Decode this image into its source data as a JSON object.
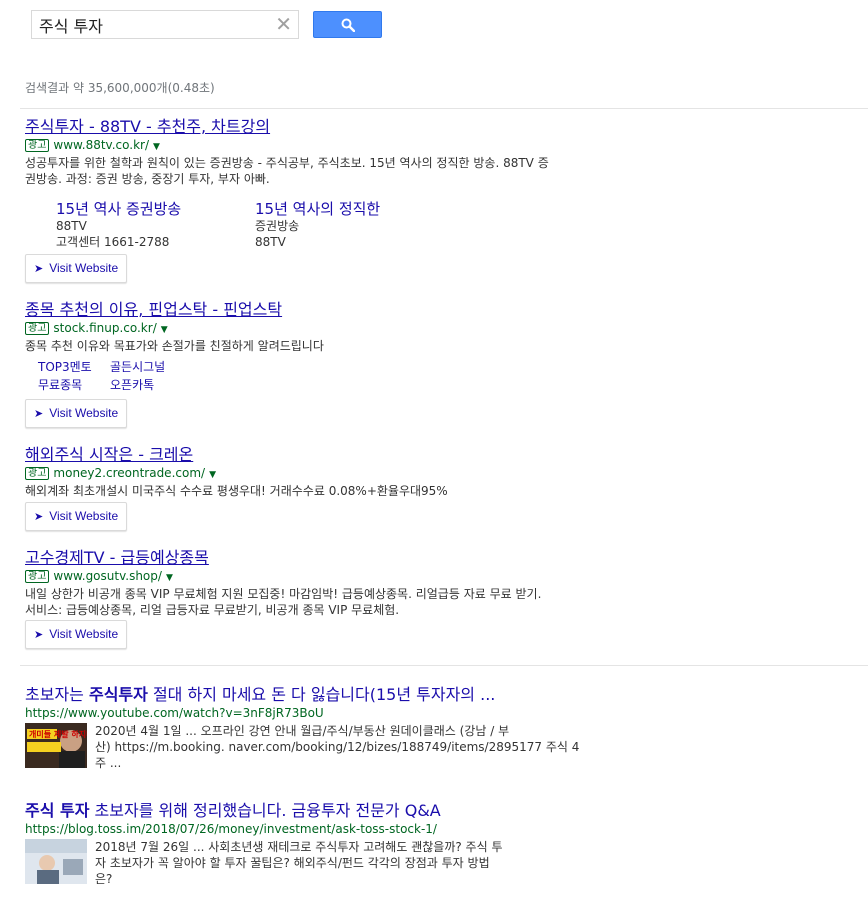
{
  "search": {
    "query": "주식 투자",
    "clear_glyph": "✕",
    "button_icon": "search-icon",
    "stats": "검색결과 약 35,600,000개(0.48초)"
  },
  "colors": {
    "link": "#1a0dab",
    "url_green": "#006621",
    "button_blue": "#4d90fe"
  },
  "ads": [
    {
      "title": "주식투자 - 88TV - 추천주, 차트강의",
      "badge": "광고",
      "url": "www.88tv.co.kr/",
      "desc": [
        "성공투자를 위한 철학과 원칙이 있는 증권방송 - 주식공부, 주식초보. 15년 역사의 정직한 방송. 88TV 증",
        "권방송. 과정: 증권 방송, 중장기 투자, 부자 아빠."
      ],
      "sitelinks": [
        {
          "title": "15년 역사 증권방송",
          "lines": [
            "88TV",
            "고객센터 1661-2788"
          ]
        },
        {
          "title": "15년 역사의 정직한",
          "lines": [
            "증권방송",
            "88TV"
          ]
        }
      ],
      "visit_label": "Visit Website"
    },
    {
      "title": "종목 추천의 이유, 핀업스탁 - 핀업스탁",
      "badge": "광고",
      "url": "stock.finup.co.kr/",
      "desc": [
        "종목 추천 이유와 목표가와 손절가를 친절하게 알려드립니다"
      ],
      "small_links": [
        "TOP3멘토",
        "골든시그널",
        "무료종목",
        "오픈카톡"
      ],
      "visit_label": "Visit Website"
    },
    {
      "title": "해외주식 시작은 - 크레온",
      "badge": "광고",
      "url": "money2.creontrade.com/",
      "desc": [
        "해외계좌 최초개설시 미국주식 수수료 평생우대! 거래수수료 0.08%+환율우대95%"
      ],
      "visit_label": "Visit Website"
    },
    {
      "title": "고수경제TV - 급등예상종목",
      "badge": "광고",
      "url": "www.gosutv.shop/",
      "desc": [
        "내일 상한가 비공개 종목 VIP 무료체험 지원 모집중! 마감임박! 급등예상종목. 리얼급등 자료 무료 받기.",
        "서비스: 급등예상종목, 리얼 급등자료 무료받기, 비공개 종목 VIP 무료체험."
      ],
      "visit_label": "Visit Website"
    }
  ],
  "organic": [
    {
      "title_bold": "주식투자",
      "title_pre": "초보자는 ",
      "title_post": " 절대 하지 마세요 돈 다 잃습니다(15년 투자자의 ...",
      "url": "https://www.youtube.com/watch?v=3nF8jR73BoU",
      "thumb_text": "개미들 제발 하지마라",
      "snippet": [
        "2020년 4월 1일 ... 오프라인 강연 안내 월급/주식/부동산 원데이클래스 (강남 / 부",
        "산) https://m.booking. naver.com/booking/12/bizes/188749/items/2895177 주식 4",
        "주 ..."
      ]
    },
    {
      "title_bold": "주식 투자",
      "title_pre": "",
      "title_post": " 초보자를 위해 정리했습니다. 금융투자 전문가 Q&A",
      "url": "https://blog.toss.im/2018/07/26/money/investment/ask-toss-stock-1/",
      "snippet": [
        "2018년 7월 26일 ... 사회초년생 재테크로 주식투자 고려해도 괜찮을까? 주식 투",
        "자 초보자가 꼭 알아야 할 투자 꿀팁은? 해외주식/펀드 각각의 장점과 투자 방법",
        "은?"
      ]
    }
  ]
}
